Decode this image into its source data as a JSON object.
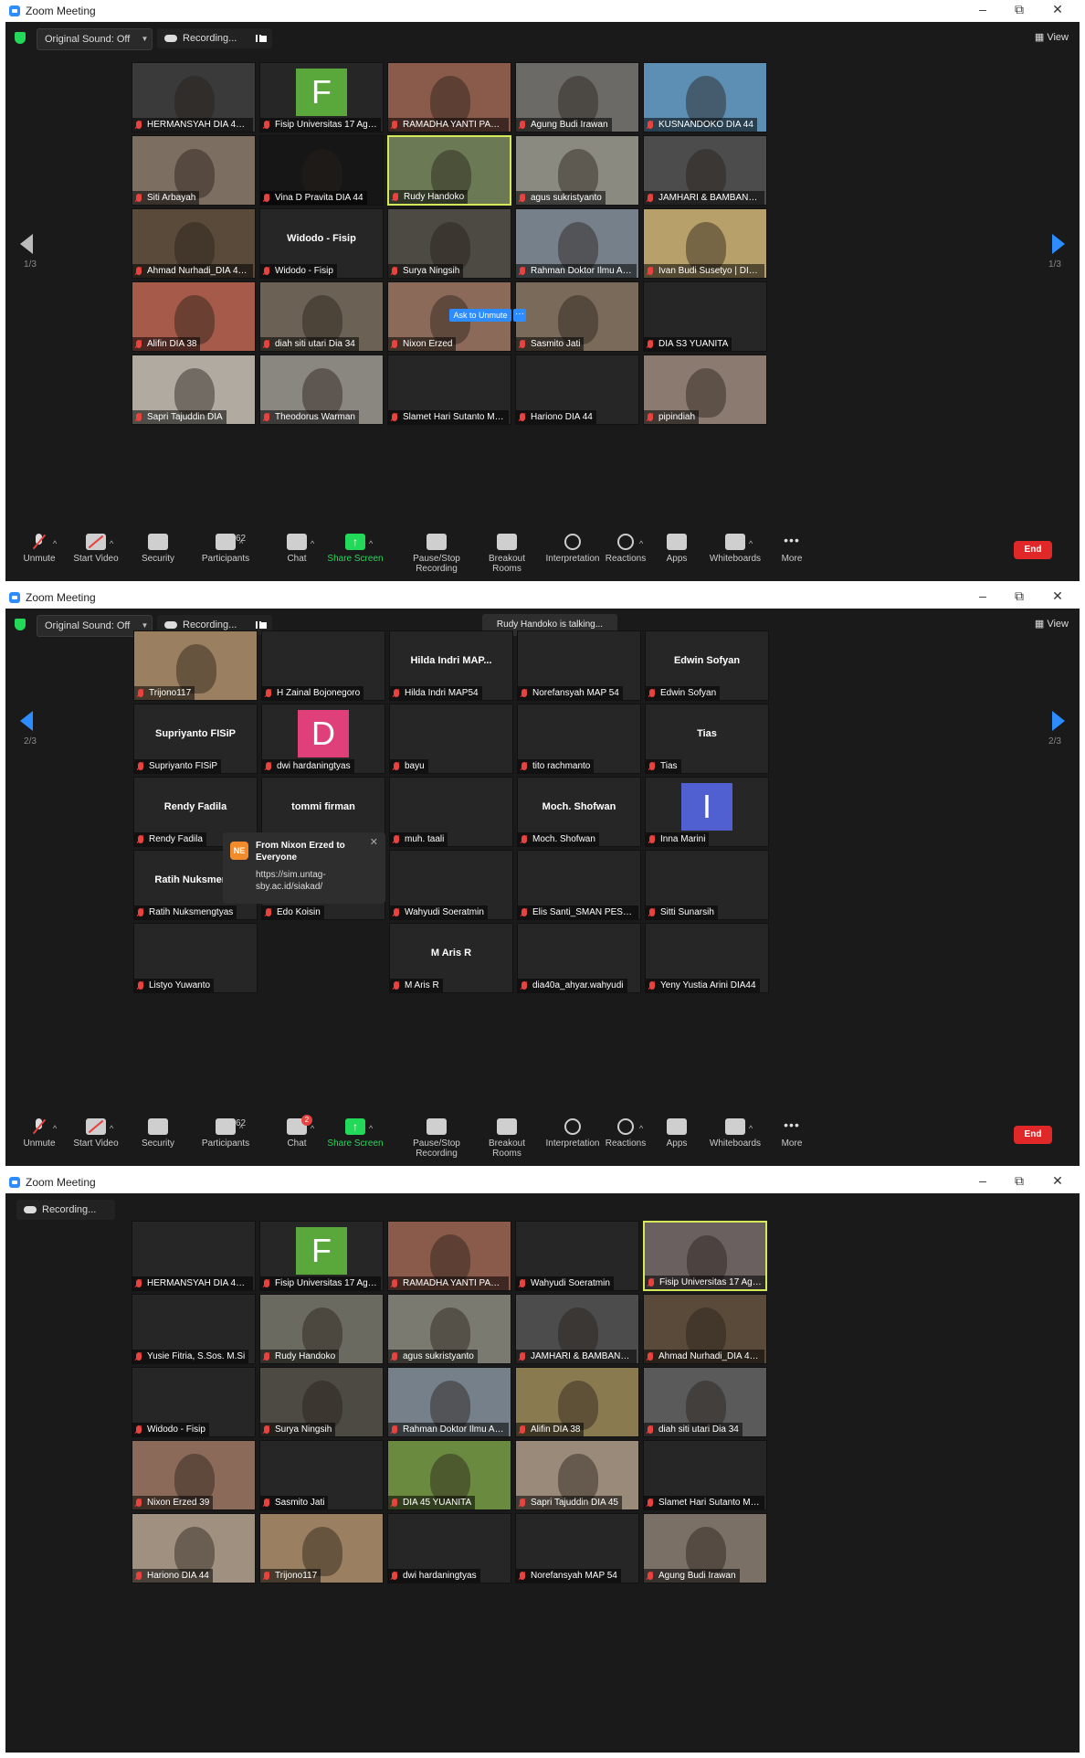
{
  "window_title": "Zoom Meeting",
  "window_controls": {
    "minimize": "–",
    "maximize": "⧉",
    "close": "✕"
  },
  "top": {
    "sound_label": "Original Sound: Off",
    "recording_label": "Recording...",
    "view_label": "View",
    "talking_label": "Rudy Handoko is talking..."
  },
  "pages": {
    "p1": "1/3",
    "p2": "2/3"
  },
  "toolbar": {
    "unmute": "Unmute",
    "start_video": "Start Video",
    "security": "Security",
    "participants": "Participants",
    "participants_count": "62",
    "chat": "Chat",
    "chat_badge": "2",
    "share_screen": "Share Screen",
    "pause_recording": "Pause/Stop Recording",
    "breakout": "Breakout Rooms",
    "interpretation": "Interpretation",
    "reactions": "Reactions",
    "apps": "Apps",
    "whiteboards": "Whiteboards",
    "more": "More",
    "end": "End"
  },
  "ask_to_unmute": "Ask to Unmute",
  "ask_more": "···",
  "chat_popup": {
    "initials": "NE",
    "from": "From Nixon Erzed to Everyone",
    "message": "https://sim.untag-sby.ac.id/siakad/",
    "close": "✕"
  },
  "screen1": {
    "tiles": [
      {
        "name": "HERMANSYAH DIA 45 BER...",
        "bg": "#3a3a3a",
        "big": ""
      },
      {
        "name": "Fisip Universitas 17 Agustu...",
        "bg": "#262626",
        "big": "",
        "letter": "F",
        "letter_bg": "#5aa83c"
      },
      {
        "name": "RAMADHA YANTI PARINDU...",
        "bg": "#8a5a4a",
        "big": ""
      },
      {
        "name": "Agung Budi Irawan",
        "bg": "#6b6a66",
        "big": ""
      },
      {
        "name": "KUSNANDOKO DIA 44",
        "bg": "#5c8fb3",
        "big": ""
      },
      {
        "name": "Siti Arbayah",
        "bg": "#7d6e62",
        "big": ""
      },
      {
        "name": "Vina D Pravita DIA 44",
        "bg": "#161616",
        "big": ""
      },
      {
        "name": "Rudy Handoko",
        "bg": "#6b7a55",
        "big": ""
      },
      {
        "name": "agus sukristyanto",
        "bg": "#8a8a80",
        "big": ""
      },
      {
        "name": "JAMHARI & BAMBANG PR...",
        "bg": "#4c4c4c",
        "big": ""
      },
      {
        "name": "Ahmad Nurhadi_DIA 44_Gr...",
        "bg": "#5a4a3a",
        "big": ""
      },
      {
        "name": "Widodo - Fisip",
        "bg": "#262626",
        "big": "Widodo - Fisip"
      },
      {
        "name": "Surya Ningsih",
        "bg": "#4d4a44",
        "big": ""
      },
      {
        "name": "Rahman Doktor Ilmu Admi...",
        "bg": "#76808a",
        "big": ""
      },
      {
        "name": "Ivan Budi Susetyo | DIA 41",
        "bg": "#b8a06a",
        "big": ""
      },
      {
        "name": "Alifin DIA 38",
        "bg": "#a55a4a",
        "big": ""
      },
      {
        "name": "diah siti utari Dia 34",
        "bg": "#6b6255",
        "big": ""
      },
      {
        "name": "Nixon Erzed",
        "bg": "#8c6a5a",
        "big": ""
      },
      {
        "name": "Sasmito Jati",
        "bg": "#7a6a5a",
        "big": ""
      },
      {
        "name": "DIA S3 YUANITA",
        "bg": "#262626",
        "big": ""
      },
      {
        "name": "Sapri Tajuddin DIA",
        "bg": "#b0aaa0",
        "big": ""
      },
      {
        "name": "Theodorus Warman",
        "bg": "#8a8680",
        "big": ""
      },
      {
        "name": "Slamet Hari Sutanto MAP 54",
        "bg": "#262626",
        "big": ""
      },
      {
        "name": "Hariono DIA 44",
        "bg": "#262626",
        "big": ""
      },
      {
        "name": "pipindiah",
        "bg": "#8a7a70",
        "big": ""
      }
    ]
  },
  "screen2": {
    "tiles": [
      {
        "name": "Trijono117",
        "bg": "#9a8060",
        "big": ""
      },
      {
        "name": "H Zainal Bojonegoro",
        "bg": "#262626",
        "big": ""
      },
      {
        "name": "Hilda Indri MAP54",
        "bg": "#262626",
        "big": "Hilda  Indri  MAP..."
      },
      {
        "name": "Norefansyah MAP 54",
        "bg": "#262626",
        "big": ""
      },
      {
        "name": "Edwin Sofyan",
        "bg": "#262626",
        "big": "Edwin Sofyan"
      },
      {
        "name": "Supriyanto FISiP",
        "bg": "#262626",
        "big": "Supriyanto FISiP"
      },
      {
        "name": "dwi hardaningtyas",
        "bg": "#262626",
        "big": "",
        "letter": "D",
        "letter_bg": "#e0407a"
      },
      {
        "name": "bayu",
        "bg": "#262626",
        "big": ""
      },
      {
        "name": "tito rachmanto",
        "bg": "#262626",
        "big": ""
      },
      {
        "name": "Tias",
        "bg": "#262626",
        "big": "Tias"
      },
      {
        "name": "Rendy Fadila",
        "bg": "#262626",
        "big": "Rendy Fadila"
      },
      {
        "name": "tommi firman",
        "bg": "#262626",
        "big": "tommi firman"
      },
      {
        "name": "muh. taali",
        "bg": "#262626",
        "big": ""
      },
      {
        "name": "Moch. Shofwan",
        "bg": "#262626",
        "big": "Moch. Shofwan"
      },
      {
        "name": "Inna Marini",
        "bg": "#262626",
        "big": "",
        "letter": "I",
        "letter_bg": "#5060d0"
      },
      {
        "name": "Ratih Nuksmengtyas",
        "bg": "#262626",
        "big": "Ratih  Nuksmen..."
      },
      {
        "name": "Edo Koisin",
        "bg": "#262626",
        "big": "Edo Koisin"
      },
      {
        "name": "Wahyudi Soeratmin",
        "bg": "#262626",
        "big": ""
      },
      {
        "name": "Elis Santi_SMAN PESANGG...",
        "bg": "#262626",
        "big": ""
      },
      {
        "name": "Sitti Sunarsih",
        "bg": "#262626",
        "big": ""
      },
      {
        "name": "Listyo Yuwanto",
        "bg": "#262626",
        "big": ""
      },
      {
        "name": "",
        "bg": "#262626",
        "big": ""
      },
      {
        "name": "M Aris R",
        "bg": "#262626",
        "big": "M Aris R"
      },
      {
        "name": "dia40a_ahyar.wahyudi",
        "bg": "#262626",
        "big": ""
      },
      {
        "name": "Yeny Yustia Arini DIA44",
        "bg": "#262626",
        "big": ""
      }
    ]
  },
  "screen3": {
    "tiles": [
      {
        "name": "HERMANSYAH DIA 45 BER...",
        "bg": "#262626",
        "big": ""
      },
      {
        "name": "Fisip Universitas 17 Agustu...",
        "bg": "#262626",
        "big": "",
        "letter": "F",
        "letter_bg": "#5aa83c"
      },
      {
        "name": "RAMADHA YANTI PARINDU...",
        "bg": "#8a5a4a",
        "big": ""
      },
      {
        "name": "Wahyudi Soeratmin",
        "bg": "#262626",
        "big": ""
      },
      {
        "name": "Fisip Universitas 17 Agustus S...",
        "bg": "#6a6060",
        "big": ""
      },
      {
        "name": "Yusie Fitria, S.Sos. M.Si",
        "bg": "#262626",
        "big": ""
      },
      {
        "name": "Rudy Handoko",
        "bg": "#6b6a60",
        "big": ""
      },
      {
        "name": "agus sukristyanto",
        "bg": "#7a7a70",
        "big": ""
      },
      {
        "name": "JAMHARI & BAMBANG PR...",
        "bg": "#4c4c4c",
        "big": ""
      },
      {
        "name": "Ahmad Nurhadi_DIA 44_Gr...",
        "bg": "#5a4a3a",
        "big": ""
      },
      {
        "name": "Widodo - Fisip",
        "bg": "#262626",
        "big": ""
      },
      {
        "name": "Surya Ningsih",
        "bg": "#4d4a44",
        "big": ""
      },
      {
        "name": "Rahman Doktor Ilmu Admi...",
        "bg": "#76808a",
        "big": ""
      },
      {
        "name": "Alifin DIA 38",
        "bg": "#8a7a50",
        "big": ""
      },
      {
        "name": "diah siti utari Dia 34",
        "bg": "#5a5a5a",
        "big": ""
      },
      {
        "name": "Nixon Erzed 39",
        "bg": "#8c6a5a",
        "big": ""
      },
      {
        "name": "Sasmito Jati",
        "bg": "#262626",
        "big": ""
      },
      {
        "name": "DIA 45 YUANITA",
        "bg": "#6a8a40",
        "big": ""
      },
      {
        "name": "Sapri Tajuddin DIA 45",
        "bg": "#9a8a7a",
        "big": ""
      },
      {
        "name": "Slamet Hari Sutanto MAP 54",
        "bg": "#262626",
        "big": ""
      },
      {
        "name": "Hariono DIA 44",
        "bg": "#a09080",
        "big": ""
      },
      {
        "name": "Trijono117",
        "bg": "#9a8060",
        "big": ""
      },
      {
        "name": "dwi hardaningtyas",
        "bg": "#262626",
        "big": ""
      },
      {
        "name": "Norefansyah MAP 54",
        "bg": "#262626",
        "big": ""
      },
      {
        "name": "Agung Budi Irawan",
        "bg": "#7a7066",
        "big": ""
      }
    ]
  }
}
